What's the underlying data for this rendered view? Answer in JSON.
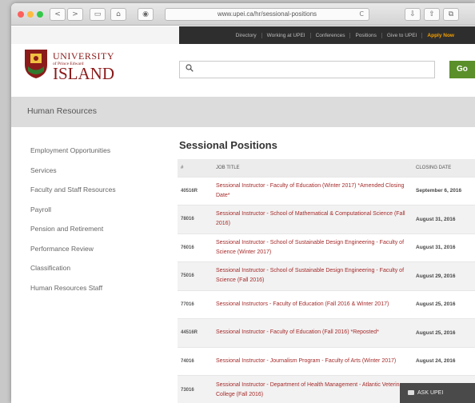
{
  "browser": {
    "url": "www.upei.ca/hr/sessional-positions",
    "nav_back": "<",
    "nav_forward": ">",
    "reload": "C"
  },
  "utility_nav": [
    "Directory",
    "Working at UPEI",
    "Conferences",
    "Positions",
    "Give to UPEI",
    "Apply Now"
  ],
  "logo": {
    "line1": "UNIVERSITY",
    "line2": "of Prince Edward",
    "line3": "ISLAND"
  },
  "search": {
    "value": "",
    "placeholder": "",
    "button": "Go"
  },
  "section_title": "Human Resources",
  "sidebar": {
    "items": [
      "Employment Opportunities",
      "Services",
      "Faculty and Staff Resources",
      "Payroll",
      "Pension and Retirement",
      "Performance Review",
      "Classification",
      "Human Resources Staff"
    ]
  },
  "main": {
    "title": "Sessional Positions",
    "columns": [
      "#",
      "JOB TITLE",
      "CLOSING DATE"
    ],
    "rows": [
      {
        "num": "40516R",
        "title": "Sessional Instructor - Faculty of Education (Winter 2017) *Amended Closing Date*",
        "date": "September 6, 2016"
      },
      {
        "num": "78016",
        "title": "Sessional Instructor - School of Mathematical & Computational Science (Fall 2016)",
        "date": "August 31, 2016"
      },
      {
        "num": "76016",
        "title": "Sessional Instructor - School of Sustainable Design Engineering - Faculty of Science (Winter 2017)",
        "date": "August 31, 2016"
      },
      {
        "num": "75016",
        "title": "Sessional Instructor - School of Sustainable Design Engineering - Faculty of Science (Fall 2016)",
        "date": "August 29, 2016"
      },
      {
        "num": "77016",
        "title": "Sessional Instructors - Faculty of Education (Fall 2016 & Winter 2017)",
        "date": "August 25, 2016"
      },
      {
        "num": "44516R",
        "title": "Sessional Instructor - Faculty of Education (Fall 2016) *Reposted*",
        "date": "August 25, 2016"
      },
      {
        "num": "74016",
        "title": "Sessional Instructor - Journalism Program - Faculty of Arts (Winter 2017)",
        "date": "August 24, 2016"
      },
      {
        "num": "73016",
        "title": "Sessional Instructor - Department of Health Management - Atlantic Veterinary College (Fall 2016)",
        "date": ""
      }
    ]
  },
  "ask_button": "ASK UPEI",
  "colors": {
    "brand_red": "#8b1a1a",
    "link_red": "#a52a2a",
    "go_green": "#5a8f2a",
    "apply_orange": "#f5a000"
  }
}
